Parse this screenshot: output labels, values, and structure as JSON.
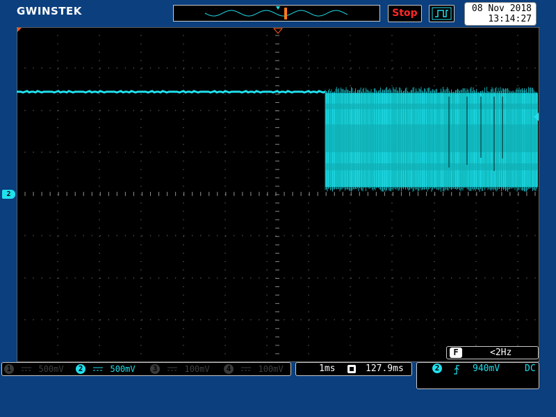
{
  "brand": {
    "logo_text": "GWINSTEK"
  },
  "toolbar": {
    "stop_label": "Stop",
    "trigger_mode_icon": "pulse-icon"
  },
  "datetime": {
    "date": "08 Nov 2018",
    "time": "13:14:27"
  },
  "screen": {
    "ch2_marker": "2",
    "trace_color": "#20e0ee",
    "background": "#000000"
  },
  "frequency": {
    "badge": "F",
    "value": "<2Hz"
  },
  "channels": [
    {
      "num": "1",
      "coupling": "DC",
      "scale": "500mV",
      "active": false
    },
    {
      "num": "2",
      "coupling": "DC",
      "scale": "500mV",
      "active": true
    },
    {
      "num": "3",
      "coupling": "DC",
      "scale": "100mV",
      "active": false
    },
    {
      "num": "4",
      "coupling": "DC",
      "scale": "100mV",
      "active": false
    }
  ],
  "timebase": {
    "scale": "1ms",
    "position_icon": "h-position-icon",
    "position": "127.9ms"
  },
  "trigger": {
    "source": "2",
    "slope_icon": "rising-edge-icon",
    "level": "940mV",
    "coupling": "DC"
  },
  "colors": {
    "background": "#0b3f7e",
    "ch2": "#20e0ee",
    "stop": "#ff2828",
    "trigger_marker": "#ff5a1e"
  }
}
